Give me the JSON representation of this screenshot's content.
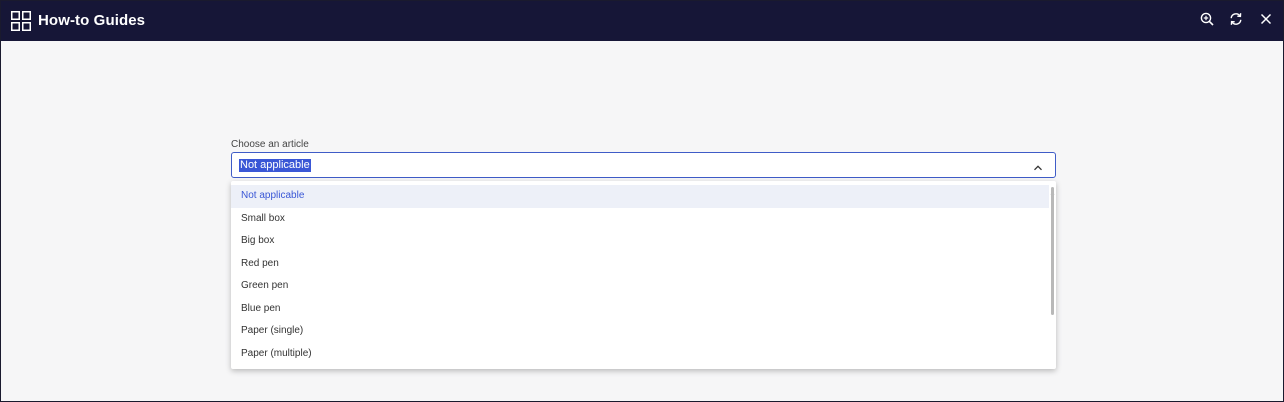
{
  "window": {
    "title": "How-to Guides",
    "colors": {
      "titlebar": "#161637",
      "accent": "#3a57d6"
    }
  },
  "toolbar": {
    "zoom_icon": "zoom-in-icon",
    "refresh_icon": "refresh-icon",
    "close_icon": "close-icon"
  },
  "form": {
    "label": "Choose an article",
    "selected_value": "Not applicable",
    "options": [
      "Not applicable",
      "Small box",
      "Big box",
      "Red pen",
      "Green pen",
      "Blue pen",
      "Paper (single)",
      "Paper (multiple)"
    ]
  }
}
